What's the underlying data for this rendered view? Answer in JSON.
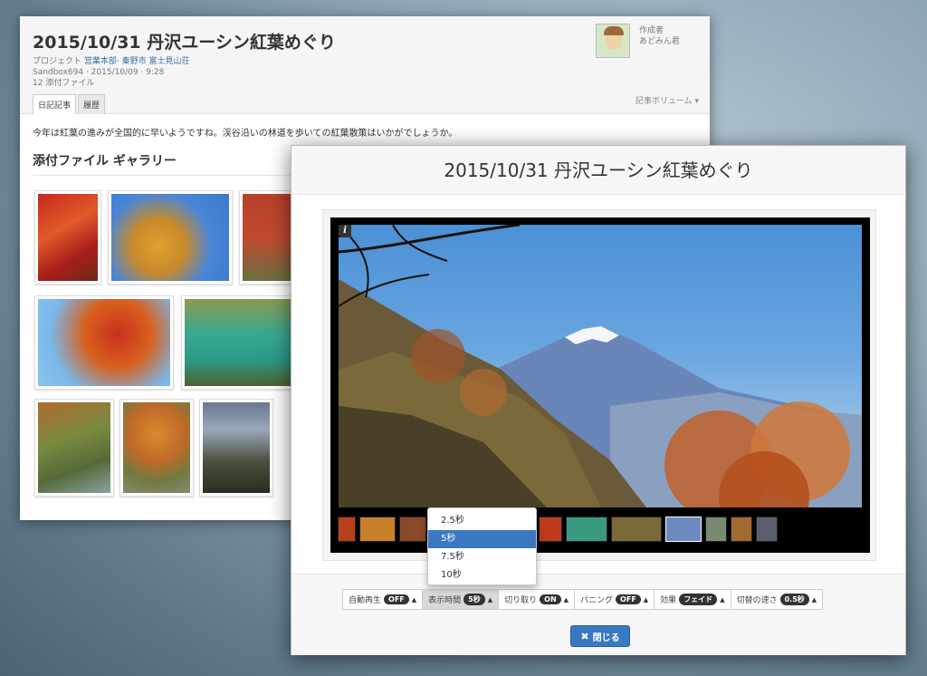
{
  "article": {
    "title": "2015/10/31 丹沢ユーシン紅葉めぐり",
    "project_label": "プロジェクト",
    "project_links": "営業本部· 秦野市 富士見山荘",
    "created": "Sandbox694 · 2015/10/09 · 9:28",
    "attachments": "12 添付ファイル",
    "author_role": "作成者",
    "author_name": "あどみん君",
    "tabs": [
      "日記記事",
      "履歴"
    ],
    "volume": "記事ボリューム ▾",
    "lead": "今年は紅葉の進みが全国的に早いようですね。渓谷沿いの林道を歩いての紅葉散策はいかがでしょうか。",
    "gallery_title": "添付ファイル ギャラリー"
  },
  "modal": {
    "title": "2015/10/31 丹沢ユーシン紅葉めぐり",
    "info_icon": "i",
    "controls": [
      {
        "label": "自動再生",
        "value": "OFF"
      },
      {
        "label": "表示時間",
        "value": "5秒"
      },
      {
        "label": "切り取り",
        "value": "ON"
      },
      {
        "label": "パニング",
        "value": "OFF"
      },
      {
        "label": "効果",
        "value": "フェイド"
      },
      {
        "label": "切替の速さ",
        "value": "0.5秒"
      }
    ],
    "caret": "▲",
    "close_icon": "✖",
    "close_label": "閉じる"
  },
  "dropdown": {
    "options": [
      "2.5秒",
      "5秒",
      "7.5秒",
      "10秒"
    ],
    "selected": "5秒"
  },
  "colors": {
    "accent": "#3a78c2",
    "link": "#3a6f9e"
  }
}
